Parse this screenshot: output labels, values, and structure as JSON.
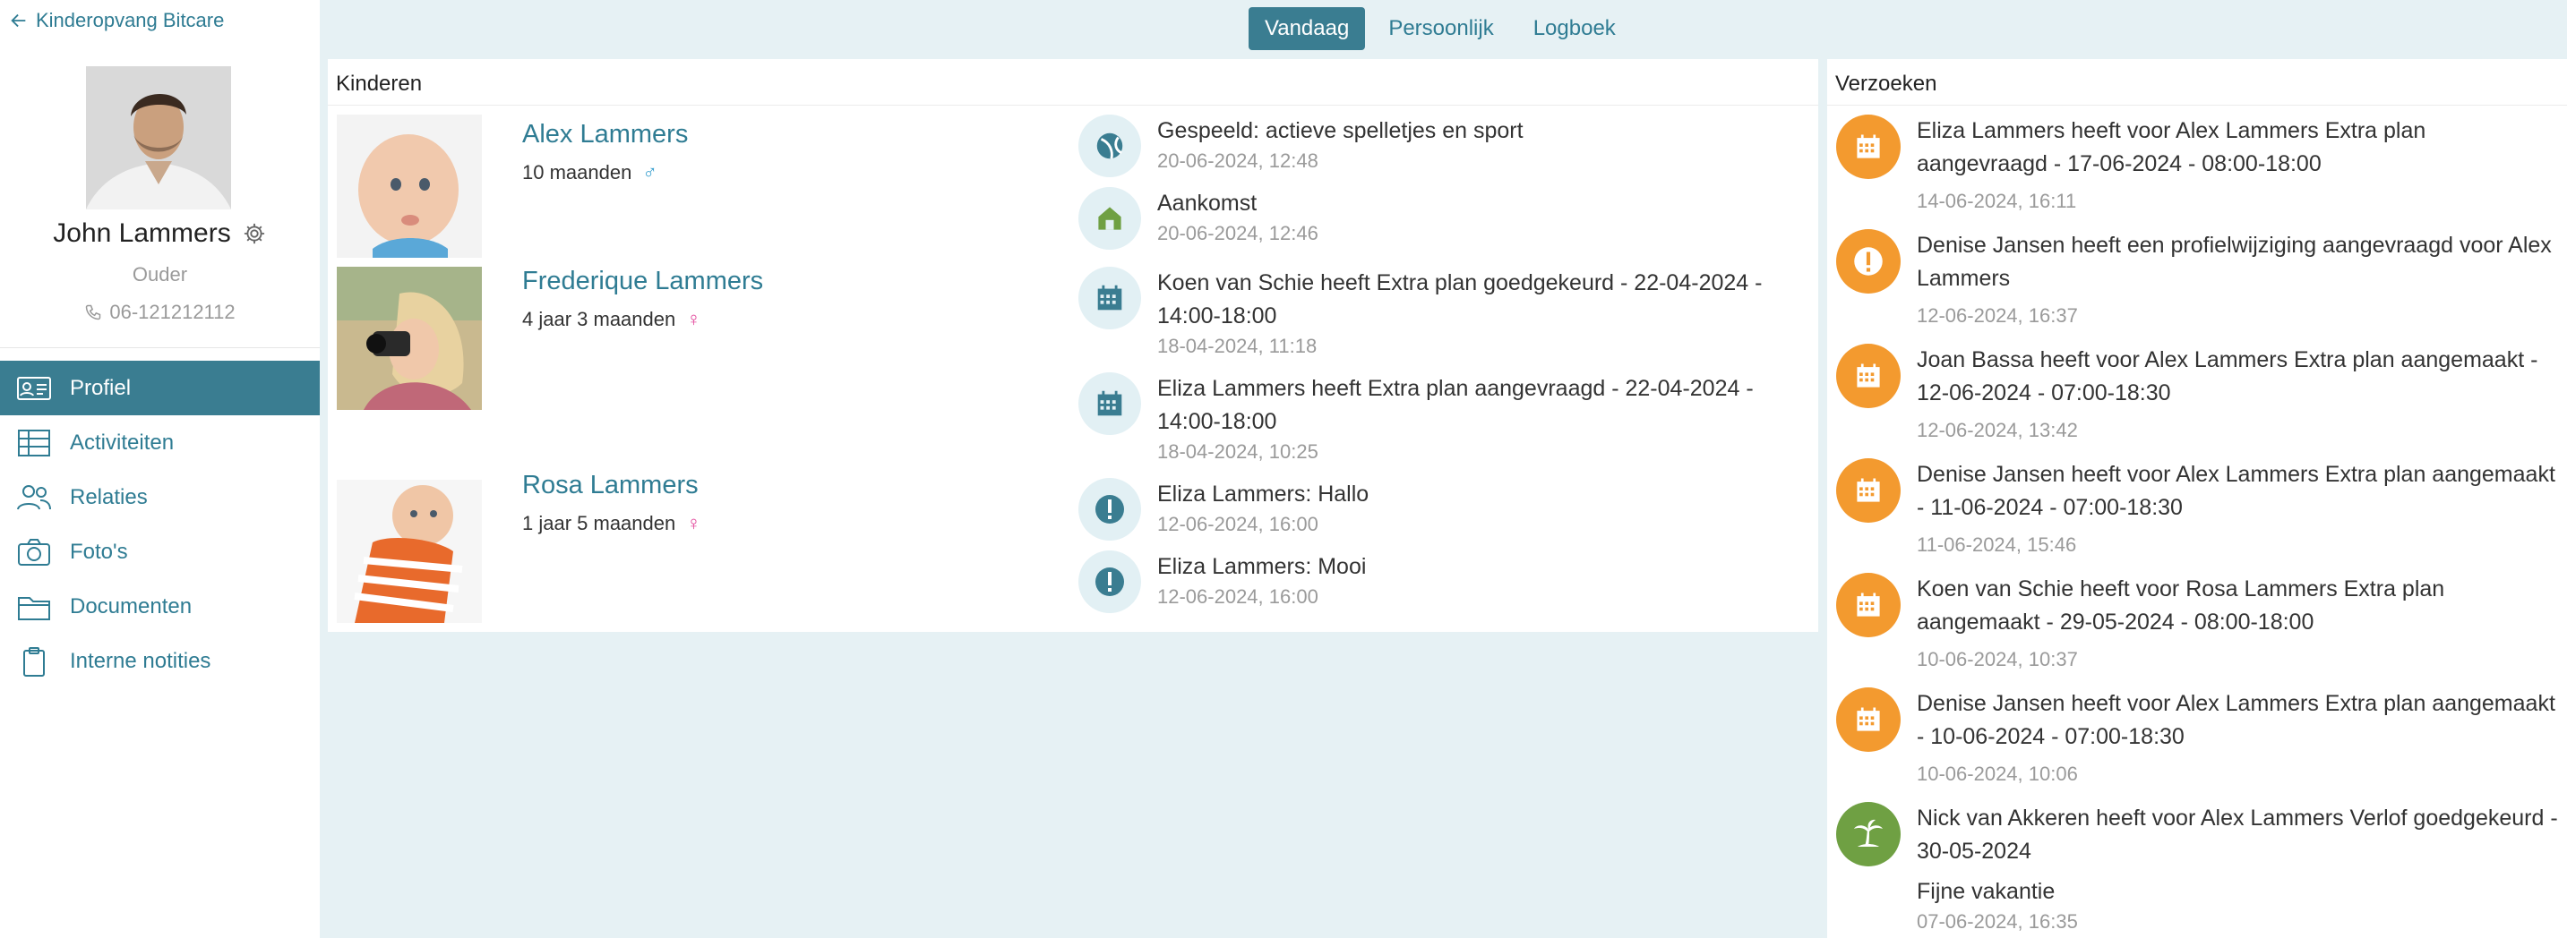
{
  "back_link": "Kinderopvang Bitcare",
  "profile": {
    "name": "John Lammers",
    "role": "Ouder",
    "phone": "06-121212112"
  },
  "nav": [
    {
      "label": "Profiel",
      "icon": "id-card-icon",
      "active": true
    },
    {
      "label": "Activiteiten",
      "icon": "table-icon",
      "active": false
    },
    {
      "label": "Relaties",
      "icon": "people-icon",
      "active": false
    },
    {
      "label": "Foto's",
      "icon": "camera-icon",
      "active": false
    },
    {
      "label": "Documenten",
      "icon": "folder-icon",
      "active": false
    },
    {
      "label": "Interne notities",
      "icon": "clipboard-icon",
      "active": false
    }
  ],
  "tabs": [
    {
      "label": "Vandaag",
      "active": true
    },
    {
      "label": "Persoonlijk",
      "active": false
    },
    {
      "label": "Logboek",
      "active": false
    }
  ],
  "kids_panel": {
    "title": "Kinderen",
    "children": [
      {
        "name": "Alex Lammers",
        "age": "10 maanden",
        "gender_symbol": "♂"
      },
      {
        "name": "Frederique Lammers",
        "age": "4 jaar 3 maanden",
        "gender_symbol": "♀"
      },
      {
        "name": "Rosa Lammers",
        "age": "1 jaar 5 maanden",
        "gender_symbol": "♀"
      }
    ],
    "events": [
      {
        "icon": "ball-icon",
        "text": "Gespeeld: actieve spelletjes en sport",
        "time": "20-06-2024, 12:48"
      },
      {
        "icon": "house-icon",
        "text": "Aankomst",
        "time": "20-06-2024, 12:46"
      },
      {
        "icon": "calendar-icon",
        "text": "Koen van Schie heeft Extra plan goedgekeurd - 22-04-2024 - 14:00-18:00",
        "time": "18-04-2024, 11:18"
      },
      {
        "icon": "calendar-icon",
        "text": "Eliza Lammers heeft Extra plan aangevraagd - 22-04-2024 - 14:00-18:00",
        "time": "18-04-2024, 10:25"
      },
      {
        "icon": "exclamation-icon",
        "text": "Eliza Lammers: Hallo",
        "time": "12-06-2024, 16:00"
      },
      {
        "icon": "exclamation-icon",
        "text": "Eliza Lammers: Mooi",
        "time": "12-06-2024, 16:00"
      }
    ]
  },
  "requests_panel": {
    "title": "Verzoeken",
    "items": [
      {
        "icon": "calendar-icon",
        "color": "#f39a2f",
        "text": "Eliza Lammers heeft voor Alex Lammers Extra plan aangevraagd - 17-06-2024 - 08:00-18:00",
        "note": "",
        "time": "14-06-2024, 16:11"
      },
      {
        "icon": "exclamation-icon",
        "color": "#f39a2f",
        "text": "Denise Jansen heeft een profielwijziging aangevraagd voor Alex Lammers",
        "note": "",
        "time": "12-06-2024, 16:37"
      },
      {
        "icon": "calendar-icon",
        "color": "#f39a2f",
        "text": "Joan Bassa heeft voor Alex Lammers Extra plan aangemaakt - 12-06-2024 - 07:00-18:30",
        "note": "",
        "time": "12-06-2024, 13:42"
      },
      {
        "icon": "calendar-icon",
        "color": "#f39a2f",
        "text": "Denise Jansen heeft voor Alex Lammers Extra plan aangemaakt - 11-06-2024 - 07:00-18:30",
        "note": "",
        "time": "11-06-2024, 15:46"
      },
      {
        "icon": "calendar-icon",
        "color": "#f39a2f",
        "text": "Koen van Schie heeft voor Rosa Lammers Extra plan aangemaakt - 29-05-2024 - 08:00-18:00",
        "note": "",
        "time": "10-06-2024, 10:37"
      },
      {
        "icon": "calendar-icon",
        "color": "#f39a2f",
        "text": "Denise Jansen heeft voor Alex Lammers Extra plan aangemaakt - 10-06-2024 - 07:00-18:30",
        "note": "",
        "time": "10-06-2024, 10:06"
      },
      {
        "icon": "palm-tree-icon",
        "color": "#6fa043",
        "text": "Nick van Akkeren heeft voor Alex Lammers Verlof goedgekeurd - 30-05-2024",
        "note": "Fijne vakantie",
        "time": "07-06-2024, 16:35"
      }
    ]
  }
}
